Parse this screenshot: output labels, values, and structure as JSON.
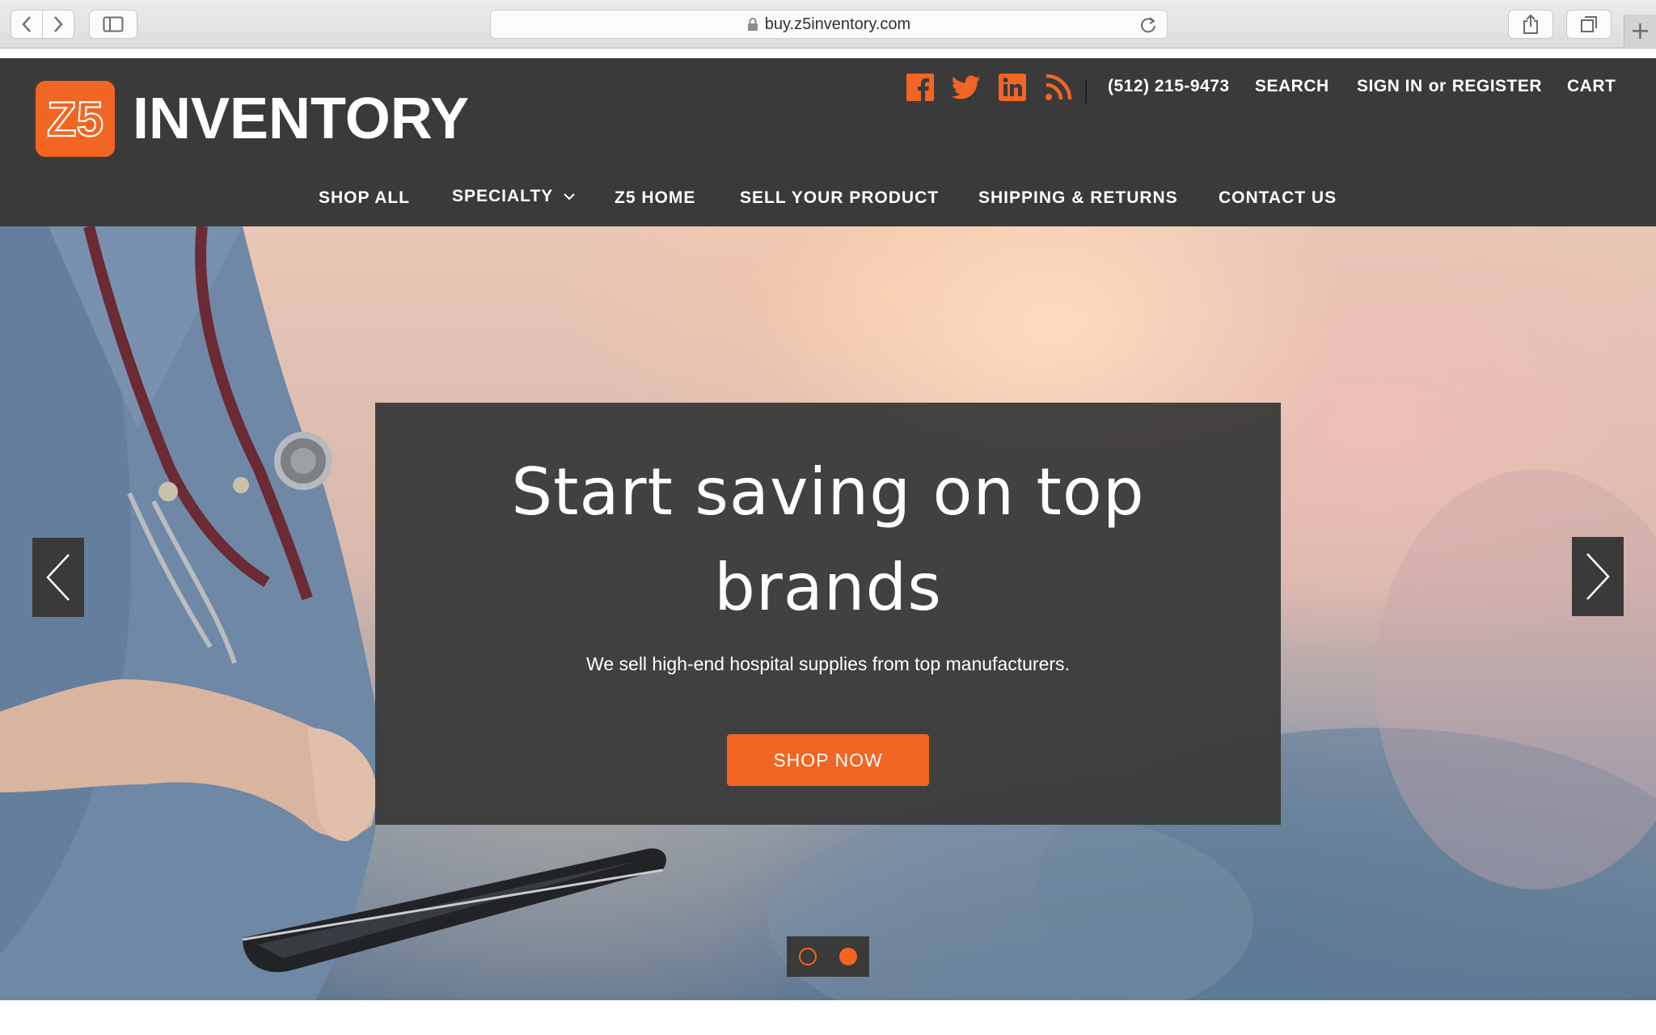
{
  "browser": {
    "url": "buy.z5inventory.com",
    "back_icon": "chevron-left-icon",
    "forward_icon": "chevron-right-icon",
    "sidebar_icon": "sidebar-icon",
    "lock_icon": "lock-icon",
    "reload_icon": "reload-icon",
    "share_icon": "share-icon",
    "tabs_icon": "tabs-icon",
    "new_tab_label": "+"
  },
  "header": {
    "logo_mark": "Z5",
    "logo_word": "INVENTORY",
    "social": [
      "facebook-icon",
      "twitter-icon",
      "linkedin-icon",
      "rss-icon"
    ],
    "phone": "(512) 215-9473",
    "search": "SEARCH",
    "sign_in": "SIGN IN",
    "or": "or",
    "register": "REGISTER",
    "cart": "CART"
  },
  "nav": {
    "items": [
      {
        "label": "SHOP ALL"
      },
      {
        "label": "SPECIALTY"
      },
      {
        "label": "Z5 HOME"
      },
      {
        "label": "SELL YOUR PRODUCT"
      },
      {
        "label": "SHIPPING & RETURNS"
      },
      {
        "label": "CONTACT US"
      }
    ]
  },
  "hero": {
    "title_line1": "Start saving on top",
    "title_line2": "brands",
    "subtitle": "We sell high-end hospital supplies from top manufacturers.",
    "cta": "SHOP NOW",
    "slide_count": 2,
    "active_slide": 2
  },
  "colors": {
    "accent": "#f26522",
    "header_bg": "#3a3a3a",
    "text_light": "#ffffff"
  }
}
